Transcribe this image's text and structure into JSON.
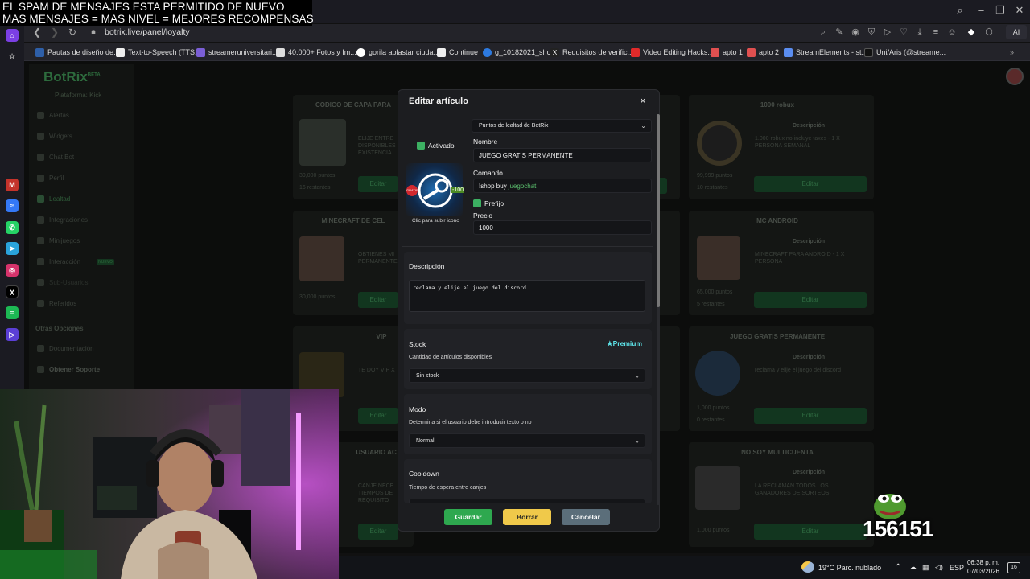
{
  "overlay": {
    "line1": "EL SPAM DE MENSAJES ESTA PERMITIDO DE NUEVO",
    "line2": "MAS MENSAJES = MAS NIVEL = MEJORES RECOMPENSAS"
  },
  "browser": {
    "url": "botrix.live/panel/loyalty",
    "ai_label": "AI",
    "bookmarks": [
      "Pautas de diseño de...",
      "Text-to-Speech (TTS...",
      "streameruniversitari...",
      "40.000+ Fotos y Im...",
      "gorila aplastar ciuda...",
      "Continue",
      "g_10182021_shcc",
      "Requisitos de verific...",
      "Video Editing Hacks...",
      "apto 1",
      "apto 2",
      "StreamElements - st...",
      "Uni/Aris (@streame..."
    ]
  },
  "botrix": {
    "logo": "BotRix",
    "logo_beta": "BETA",
    "platform": "Plataforma: Kick",
    "nav": [
      "Alertas",
      "Widgets",
      "Chat Bot",
      "Perfil",
      "Lealtad",
      "Integraciones",
      "Minijuegos",
      "Interacción",
      "Sub-Usuarios",
      "Referidos"
    ],
    "nav_badge": "NUEVO",
    "other_heading": "Otras Opciones",
    "nav_other": [
      "Documentación",
      "Obtener Soporte"
    ],
    "cards": {
      "c1_title": "CODIGO DE CAPA PARA",
      "c1_text": "ELIJE ENTRE\nDISPONIBLES\nEXISTENCIA",
      "c1_points": "39,000 puntos",
      "c1_stock": "16 restantes",
      "c2_title": "MINECRAFT DE CEL",
      "c2_text": "OBTIENES MI\nPERMANENTE",
      "c2_points": "30,000 puntos",
      "c3_title": "VIP",
      "c3_text": "TE DOY VIP X",
      "c4_title": "USUARIO ACT",
      "c4_text": "CANJE NECE\nTIEMPOS DE\nREQUISITO",
      "r1_title": "1000 robux",
      "r1_desc_label": "Descripción",
      "r1_desc": "1.000 robux no incluye taxes - 1 X\nPERSONA SEMANAL",
      "r1_points": "99,999 puntos",
      "r1_stock": "10 restantes",
      "r2_title": "MC ANDROID",
      "r2_desc_label": "Descripción",
      "r2_desc": "MINECRAFT PARA ANDROID - 1 X\nPERSONA",
      "r2_points": "65,000 puntos",
      "r2_stock": "5 restantes",
      "r3_title": "JUEGO GRATIS PERMANENTE",
      "r3_desc_label": "Descripción",
      "r3_desc": "reclama y elije el juego del discord",
      "r3_points": "1,000 puntos",
      "r3_stock": "0 restantes",
      "r4_title": "NO SOY MULTICUENTA",
      "r4_desc_label": "Descripción",
      "r4_desc": "LA RECLAMAN TODOS LOS\nGANADORES DE SORTEOS",
      "r4_points": "1,000 puntos",
      "edit": "Editar"
    }
  },
  "modal": {
    "title": "Editar artículo",
    "close": "×",
    "currency": "Puntos de lealtad de BotRix",
    "activated_label": "Activado",
    "name_label": "Nombre",
    "name_value": "JUEGO GRATIS PERMANENTE",
    "command_label": "Comando",
    "command_prefix": "!shop buy ",
    "command_value": "juegochat",
    "prefix_label": "Prefijo",
    "price_label": "Precio",
    "price_value": "1000",
    "image_caption": "Clic para subir icono",
    "image_badge_left": "GRATIS",
    "image_badge_right": "-100",
    "description_label": "Descripción",
    "description_value": "reclama y elije el juego del discord",
    "stock_label": "Stock",
    "premium_label": "Premium",
    "stock_sub": "Cantidad de artículos disponibles",
    "stock_value": "Sin stock",
    "mode_label": "Modo",
    "mode_sub": "Determina si el usuario debe introducir texto o no",
    "mode_value": "Normal",
    "cooldown_label": "Cooldown",
    "cooldown_sub": "Tiempo de espera entre canjes",
    "save": "Guardar",
    "delete": "Borrar",
    "cancel": "Cancelar"
  },
  "stream": {
    "counter": "156151"
  },
  "taskbar": {
    "weather": "19°C  Parc. nublado",
    "lang": "ESP",
    "time": "06:38 p. m.",
    "date": "07/03/2026",
    "notif_count": "16"
  },
  "colors": {
    "accent_green": "#3cb062",
    "save_green": "#2ea84f",
    "delete_yellow": "#f0c94a",
    "cancel_gray": "#5b6e7a",
    "premium_cyan": "#5ce1e6"
  }
}
